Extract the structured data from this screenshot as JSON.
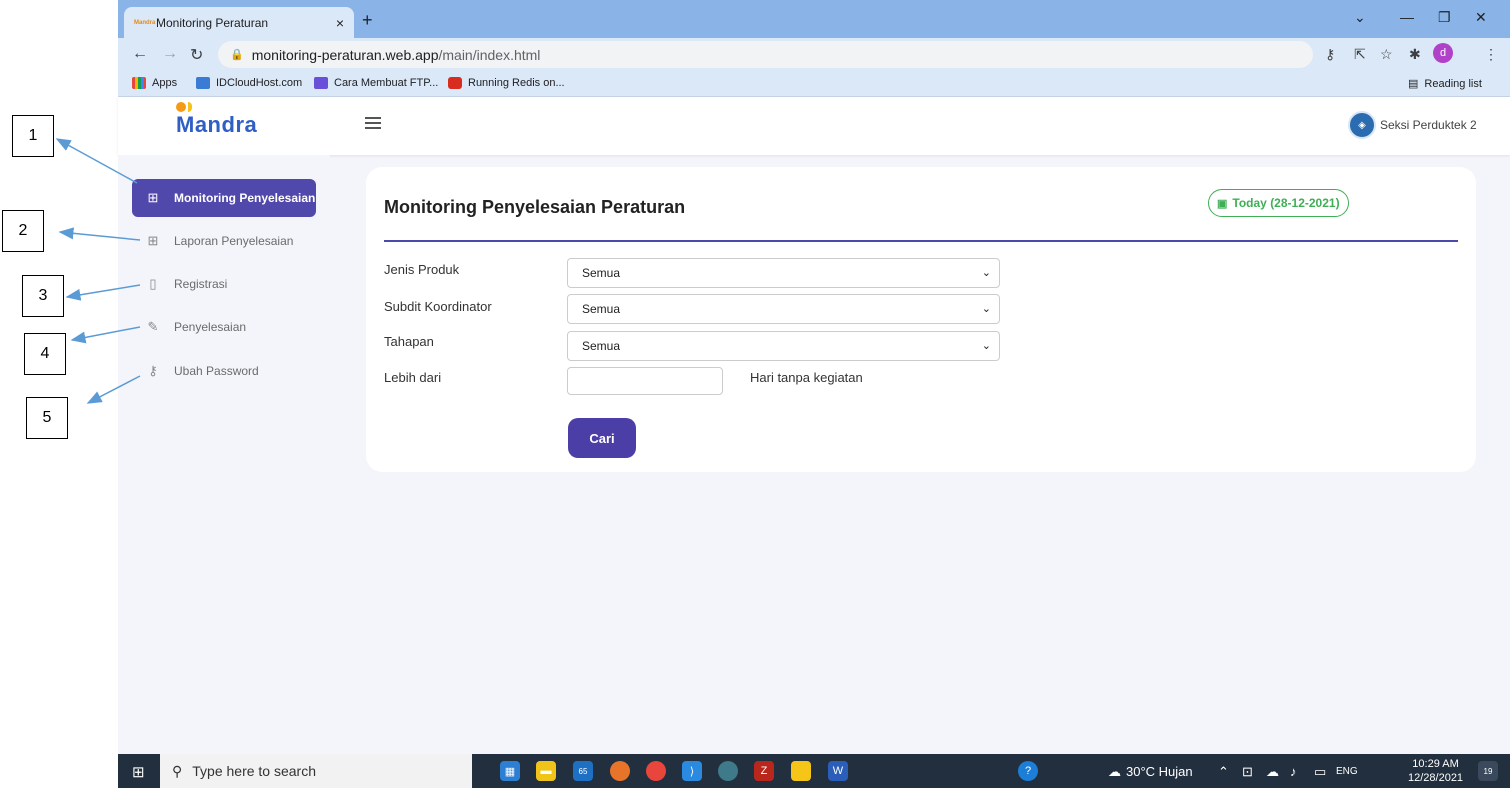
{
  "browser": {
    "tab_title": "Monitoring Peraturan",
    "tab_favicon_text": "Mandra",
    "new_tab": "+",
    "close_tab": "×",
    "url_host": "monitoring-peraturan.web.app",
    "url_path": "/main/index.html",
    "profile_initial": "d",
    "bookmarks": [
      "Apps",
      "IDCloudHost.com",
      "Cara Membuat FTP...",
      "Running Redis on..."
    ],
    "reading_list": "Reading list"
  },
  "app": {
    "logo": "Mandra",
    "user_name": "Seksi Perduktek 2",
    "sidebar": [
      {
        "label": "Monitoring Penyelesaian",
        "icon": "grid-icon",
        "active": true
      },
      {
        "label": "Laporan Penyelesaian",
        "icon": "grid-icon",
        "active": false
      },
      {
        "label": "Registrasi",
        "icon": "book-icon",
        "active": false
      },
      {
        "label": "Penyelesaian",
        "icon": "edit-icon",
        "active": false
      },
      {
        "label": "Ubah Password",
        "icon": "key-icon",
        "active": false
      }
    ],
    "card": {
      "title": "Monitoring Penyelesaian Peraturan",
      "today": "Today (28-12-2021)",
      "fields": [
        {
          "label": "Jenis Produk",
          "value": "Semua"
        },
        {
          "label": "Subdit Koordinator",
          "value": "Semua"
        },
        {
          "label": "Tahapan",
          "value": "Semua"
        }
      ],
      "lebih_label": "Lebih dari",
      "lebih_value": "",
      "lebih_suffix": "Hari tanpa kegiatan",
      "search_button": "Cari"
    }
  },
  "annotations": [
    "1",
    "2",
    "3",
    "4",
    "5"
  ],
  "taskbar": {
    "search_placeholder": "Type here to search",
    "mail_badge": "65",
    "weather": "30°C Hujan",
    "lang": "ENG",
    "time": "10:29 AM",
    "date": "12/28/2021",
    "notif_count": "19"
  }
}
